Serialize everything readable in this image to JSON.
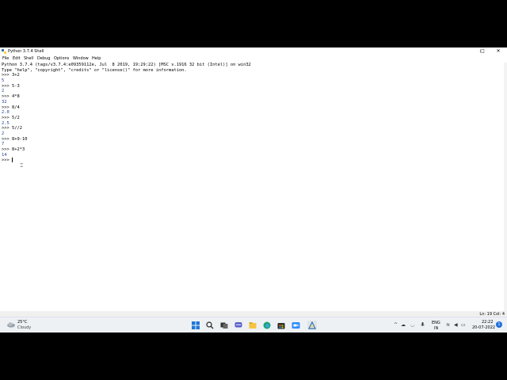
{
  "window": {
    "title": "Python 3.7.4 Shell",
    "controls": {
      "minimize": "–",
      "maximize": "□",
      "close": "✕"
    }
  },
  "menu": {
    "items": [
      "File",
      "Edit",
      "Shell",
      "Debug",
      "Options",
      "Window",
      "Help"
    ]
  },
  "shell": {
    "prompt": ">>> ",
    "banner": [
      "Python 3.7.4 (tags/v3.7.4:e09359112e, Jul  8 2019, 19:29:22) [MSC v.1916 32 bit (Intel)] on win32",
      "Type \"help\", \"copyright\", \"credits\" or \"license()\" for more information."
    ],
    "session": [
      {
        "input": "3+2",
        "output": "5"
      },
      {
        "input": "5-3",
        "output": "2"
      },
      {
        "input": "4*8",
        "output": "32"
      },
      {
        "input": "8/4",
        "output": "2.0"
      },
      {
        "input": "5/2",
        "output": "2.5"
      },
      {
        "input": "5//2",
        "output": "2"
      },
      {
        "input": "8+9-10",
        "output": "7"
      },
      {
        "input": "8+2*3",
        "output": "14"
      }
    ]
  },
  "status": {
    "position": "Ln: 19   Col: 4"
  },
  "taskbar": {
    "weather": {
      "temp": "25°C",
      "condition": "Cloudy",
      "icon": "cloud-icon"
    },
    "language": {
      "line1": "ENG",
      "line2": "IN"
    },
    "clock": {
      "time": "22:22",
      "date": "20-07-2022"
    },
    "notifications": "1",
    "tray_glyphs": {
      "chevron": "^",
      "onedrive": "☁",
      "network": "◡",
      "wifi": "≋",
      "volume": "◀",
      "battery": "▭"
    }
  },
  "colors": {
    "output_text": "#1f3f8f",
    "taskbar_bg": "#eef1f4",
    "accent": "#1e6fd9"
  }
}
